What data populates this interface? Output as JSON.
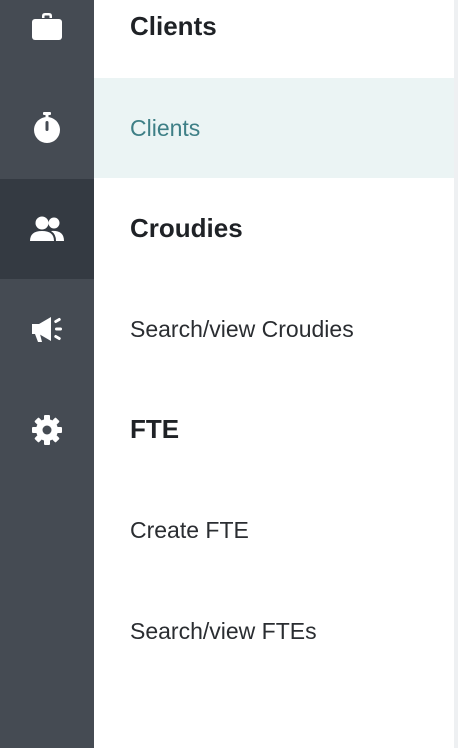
{
  "rail": {
    "items": [
      {
        "icon": "briefcase-icon",
        "active": false
      },
      {
        "icon": "stopwatch-icon",
        "active": false
      },
      {
        "icon": "users-icon",
        "active": true
      },
      {
        "icon": "megaphone-icon",
        "active": false
      },
      {
        "icon": "gear-icon",
        "active": false
      }
    ],
    "colors": {
      "background": "#454b53",
      "active_background": "#343a42",
      "icon": "#ffffff"
    }
  },
  "menu": {
    "clients_heading": "Clients",
    "clients_link": "Clients",
    "croudies_heading": "Croudies",
    "search_croudies": "Search/view Croudies",
    "fte_heading": "FTE",
    "create_fte": "Create FTE",
    "search_ftes": "Search/view FTEs",
    "colors": {
      "selected_background": "#ebf4f4",
      "selected_text": "#3e7f86"
    }
  }
}
